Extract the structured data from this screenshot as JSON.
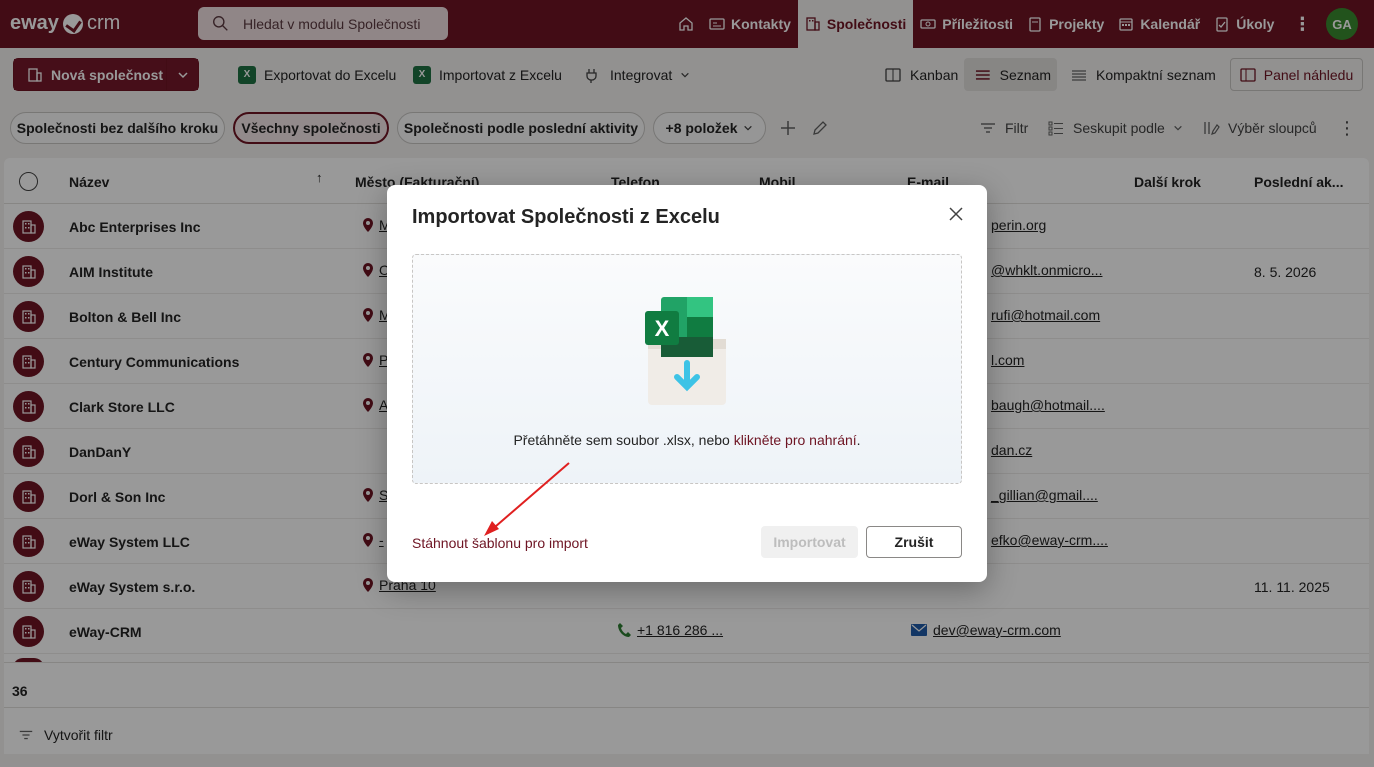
{
  "brand": {
    "logo_text_a": "eway",
    "logo_text_b": "crm"
  },
  "search": {
    "placeholder": "Hledat v modulu Společnosti"
  },
  "nav": {
    "items": [
      {
        "label": "Kontakty"
      },
      {
        "label": "Společnosti"
      },
      {
        "label": "Příležitosti"
      },
      {
        "label": "Projekty"
      },
      {
        "label": "Kalendář"
      },
      {
        "label": "Úkoly"
      }
    ],
    "more": "⋮",
    "avatar": "GA"
  },
  "toolbar": {
    "new_company": "Nová společnost",
    "export": "Exportovat do Excelu",
    "import": "Importovat z Excelu",
    "integrate": "Integrovat",
    "kanban": "Kanban",
    "list": "Seznam",
    "compact": "Kompaktní seznam",
    "preview": "Panel náhledu"
  },
  "views": {
    "chip1": "Společnosti bez dalšího kroku",
    "chip2": "Všechny společnosti",
    "chip3": "Společnosti podle poslední aktivity",
    "chip4": "+8 položek",
    "filter": "Filtr",
    "group": "Seskupit podle",
    "columns": "Výběr sloupců"
  },
  "table": {
    "headers": {
      "name": "Název",
      "city": "Město (Fakturační)",
      "phone": "Telefon",
      "mobile": "Mobil",
      "email": "E-mail",
      "next": "Další krok",
      "last": "Poslední ak..."
    },
    "rows": [
      {
        "name": "Abc Enterprises Inc",
        "city": "M",
        "email": "perin.org",
        "date": ""
      },
      {
        "name": "AIM Institute",
        "city": "O",
        "email": "@whklt.onmicro...",
        "date": "8. 5. 2026"
      },
      {
        "name": "Bolton & Bell Inc",
        "city": "M",
        "email": "rufi@hotmail.com",
        "date": ""
      },
      {
        "name": "Century Communications",
        "city": "P",
        "email": "l.com",
        "date": ""
      },
      {
        "name": "Clark Store LLC",
        "city": "A",
        "email": "baugh@hotmail....",
        "date": ""
      },
      {
        "name": "DanDanY",
        "city": "",
        "email": "dan.cz",
        "date": ""
      },
      {
        "name": "Dorl & Son Inc",
        "city": "S",
        "email": "_gillian@gmail....",
        "date": ""
      },
      {
        "name": "eWay System LLC",
        "city": "-",
        "email": "efko@eway-crm....",
        "date": ""
      },
      {
        "name": "eWay System s.r.o.",
        "city": "Praha 10",
        "email": "",
        "date": "11. 11. 2025"
      },
      {
        "name": "eWay-CRM",
        "city": "",
        "phone": "+1 816 286 ...",
        "email": "dev@eway-crm.com",
        "date": ""
      }
    ],
    "count": "36",
    "create_filter": "Vytvořit filtr"
  },
  "dialog": {
    "title": "Importovat Společnosti z Excelu",
    "drop_text": "Přetáhněte sem soubor .xlsx, nebo ",
    "drop_link": "klikněte pro nahrání",
    "drop_end": ".",
    "download_template": "Stáhnout šablonu pro import",
    "import_button": "Importovat",
    "cancel_button": "Zrušit"
  },
  "colors": {
    "brand": "#6e1423",
    "excel": "#1f7244",
    "annotation_arrow": "#e02020"
  }
}
